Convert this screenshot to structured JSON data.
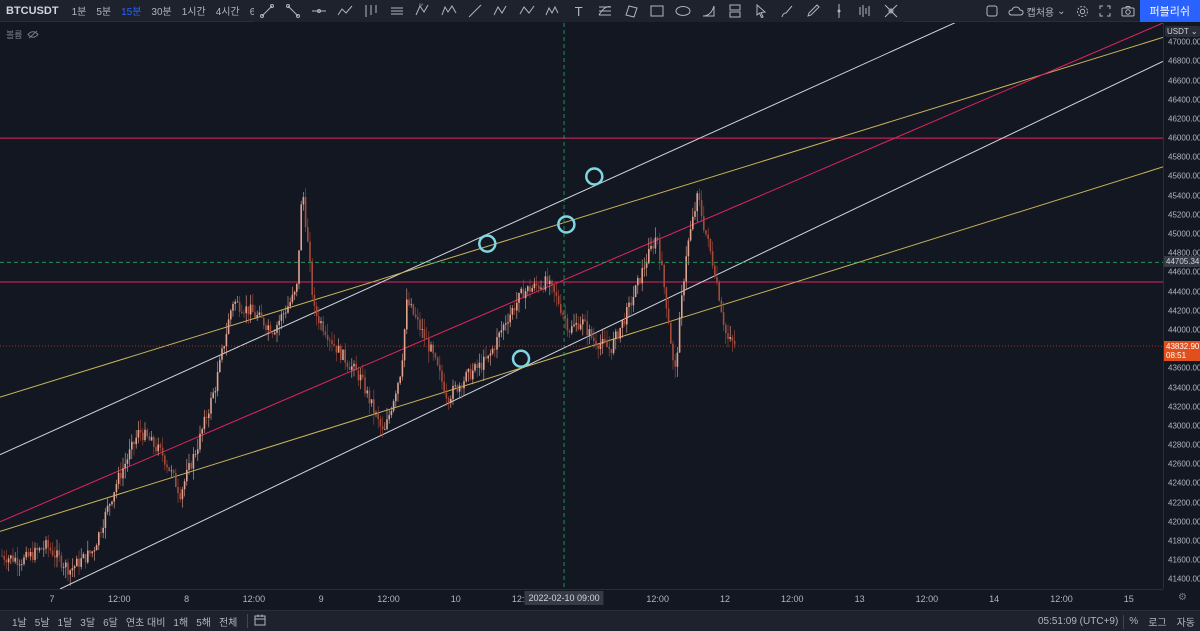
{
  "header": {
    "symbol": "BTCUSDT",
    "intervals": [
      "1분",
      "5분",
      "15분",
      "30분",
      "1시간",
      "4시간",
      "6시"
    ],
    "active_interval": "15분",
    "draw_tools": [
      "trend-line-icon",
      "ray-icon",
      "horizontal-line-icon",
      "polyline-icon",
      "pitchfork-icon",
      "parallel-channel-icon",
      "xabcd-pattern-icon",
      "elliott-wave-icon",
      "path-icon",
      "xabcd-icon",
      "abcd-pattern-icon",
      "three-drives-icon",
      "text-icon",
      "fib-retracement-icon",
      "rotated-rect-icon",
      "rectangle-icon",
      "ellipse-icon",
      "arc-icon",
      "long-position-icon",
      "cursor-icon",
      "brush-icon",
      "pencil-icon",
      "vertical-line-icon",
      "bars-icon",
      "cross-icon"
    ],
    "snapshot_label": "캡처용",
    "publish_label": "퍼블리쉬"
  },
  "legend": {
    "label": "볼륨"
  },
  "price_axis": {
    "unit": "USDT",
    "ticks": [
      "47000.00",
      "46800.00",
      "46600.00",
      "46400.00",
      "46200.00",
      "46000.00",
      "45800.00",
      "45600.00",
      "45400.00",
      "45200.00",
      "45000.00",
      "44800.00",
      "44600.00",
      "44400.00",
      "44200.00",
      "44000.00",
      "43800.00",
      "43600.00",
      "43400.00",
      "43200.00",
      "43000.00",
      "42800.00",
      "42600.00",
      "42400.00",
      "42200.00",
      "42000.00",
      "41800.00",
      "41600.00",
      "41400.00"
    ],
    "crosshair_price": "44705.34",
    "last_price": "43832.90",
    "countdown": "08:51"
  },
  "time_axis": {
    "labels": [
      "7",
      "12:00",
      "8",
      "12:00",
      "9",
      "12:00",
      "10",
      "12:00",
      "11",
      "12:00",
      "12",
      "12:00",
      "13",
      "12:00",
      "14",
      "12:00",
      "15"
    ],
    "crosshair_time": "2022-02-10  09:00"
  },
  "bottom": {
    "ranges": [
      "1날",
      "5날",
      "1달",
      "3달",
      "6달",
      "연초 대비",
      "1해",
      "5해",
      "전체"
    ],
    "clock": "05:51:09 (UTC+9)",
    "percent": "%",
    "log": "로그",
    "auto": "자동"
  },
  "chart_data": {
    "type": "candlestick",
    "y_range": [
      41300,
      47200
    ],
    "horizontal_levels": [
      46000,
      44500
    ],
    "crosshair": {
      "time_index": 0.485,
      "price": 44705.34
    },
    "last_price": 43832.9,
    "candles_close_path": [
      [
        0.0,
        41650
      ],
      [
        0.02,
        41600
      ],
      [
        0.04,
        41750
      ],
      [
        0.06,
        41500
      ],
      [
        0.08,
        41700
      ],
      [
        0.1,
        42400
      ],
      [
        0.12,
        42950
      ],
      [
        0.14,
        42700
      ],
      [
        0.155,
        42300
      ],
      [
        0.17,
        42800
      ],
      [
        0.185,
        43400
      ],
      [
        0.2,
        44300
      ],
      [
        0.215,
        44200
      ],
      [
        0.235,
        44000
      ],
      [
        0.255,
        44400
      ],
      [
        0.26,
        45500
      ],
      [
        0.27,
        44200
      ],
      [
        0.29,
        43800
      ],
      [
        0.31,
        43500
      ],
      [
        0.33,
        42900
      ],
      [
        0.345,
        43600
      ],
      [
        0.35,
        44300
      ],
      [
        0.37,
        43800
      ],
      [
        0.385,
        43300
      ],
      [
        0.4,
        43500
      ],
      [
        0.42,
        43700
      ],
      [
        0.435,
        44100
      ],
      [
        0.45,
        44400
      ],
      [
        0.47,
        44500
      ],
      [
        0.48,
        44300
      ],
      [
        0.49,
        44000
      ],
      [
        0.5,
        44100
      ],
      [
        0.51,
        43900
      ],
      [
        0.525,
        43800
      ],
      [
        0.54,
        44200
      ],
      [
        0.555,
        44700
      ],
      [
        0.565,
        45000
      ],
      [
        0.575,
        44100
      ],
      [
        0.58,
        43500
      ],
      [
        0.59,
        44800
      ],
      [
        0.6,
        45400
      ],
      [
        0.605,
        45100
      ],
      [
        0.615,
        44600
      ],
      [
        0.625,
        43900
      ],
      [
        0.632,
        43850
      ]
    ],
    "highlight_points": [
      {
        "x": 0.419,
        "y": 44900
      },
      {
        "x": 0.487,
        "y": 45100
      },
      {
        "x": 0.511,
        "y": 45600
      },
      {
        "x": 0.448,
        "y": 43700
      }
    ]
  },
  "colors": {
    "background": "#131722",
    "candle_up": "#e0a38f",
    "candle_down": "#a34a3a",
    "white_channel": "#d1d4dc",
    "yellow_channel": "#c9b458",
    "red_line": "#e0245e",
    "circle": "#7fd6e0",
    "crosshair": "#26a65b",
    "last_price_tag": "#e0501e",
    "accent": "#2962ff"
  }
}
